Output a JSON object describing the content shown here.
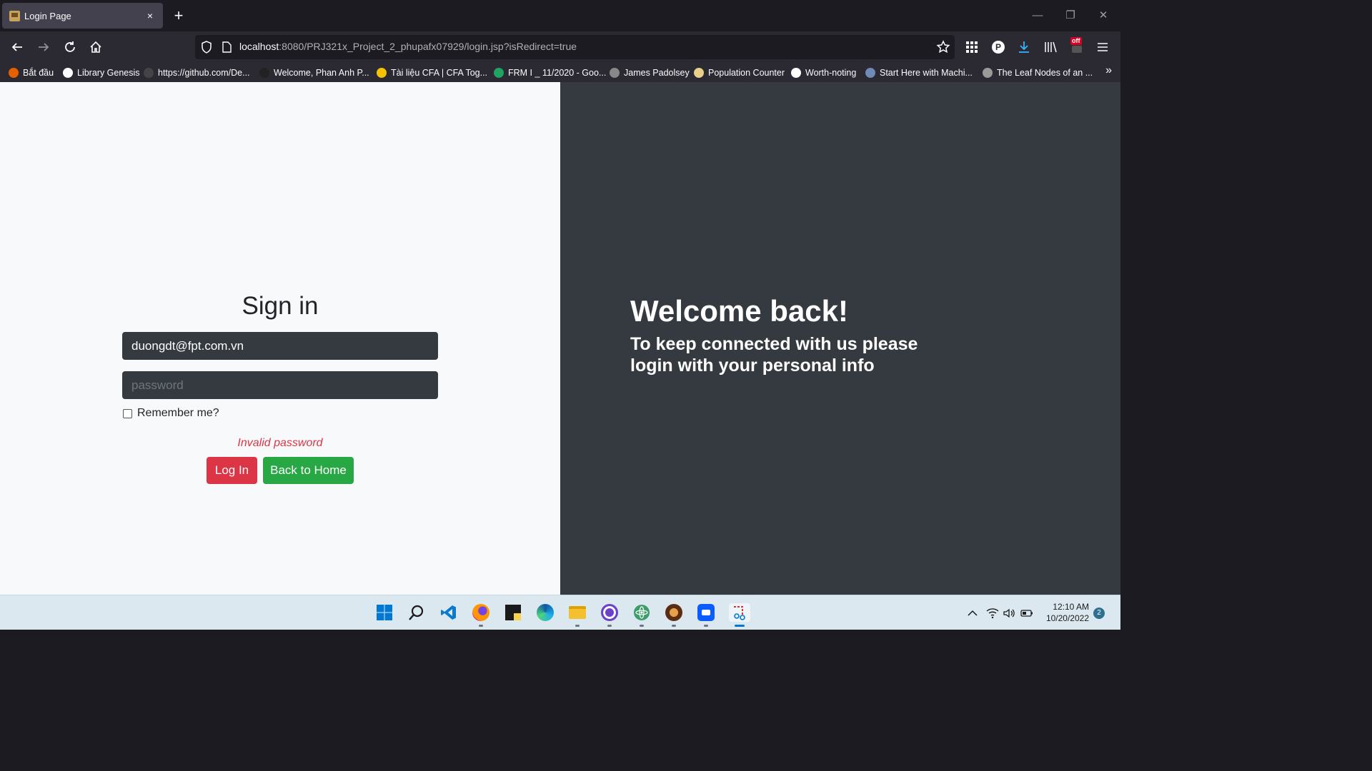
{
  "browser": {
    "tab_title": "Login Page",
    "new_tab_symbol": "+",
    "close_symbol": "×",
    "url_host": "localhost",
    "url_path": ":8080/PRJ321x_Project_2_phupafx07929/login.jsp?isRedirect=true",
    "ext_badge": "off",
    "account_letter": "P"
  },
  "bookmarks": [
    {
      "label": "Bắt đầu",
      "color": "#e66000"
    },
    {
      "label": "Library Genesis",
      "color": "#ffffff"
    },
    {
      "label": "https://github.com/De...",
      "color": "#444444"
    },
    {
      "label": "Welcome, Phan Anh P...",
      "color": "#222222"
    },
    {
      "label": "Tài liệu CFA | CFA Tog...",
      "color": "#f5c400"
    },
    {
      "label": "FRM I _ 11/2020 - Goo...",
      "color": "#1fa463"
    },
    {
      "label": "James Padolsey",
      "color": "#888888"
    },
    {
      "label": "Population Counter",
      "color": "#e8d08a"
    },
    {
      "label": "Worth-noting",
      "color": "#ffffff"
    },
    {
      "label": "Start Here with Machi...",
      "color": "#6e8ab5"
    },
    {
      "label": "The Leaf Nodes of an ...",
      "color": "#9a9a9a"
    }
  ],
  "login": {
    "title": "Sign in",
    "email_value": "duongdt@fpt.com.vn",
    "password_placeholder": "password",
    "remember_label": "Remember me?",
    "error_message": "Invalid password",
    "login_button": "Log In",
    "home_button": "Back to Home"
  },
  "welcome": {
    "title": "Welcome back!",
    "subtitle": "To keep connected with us please login with your personal info"
  },
  "taskbar": {
    "time": "12:10 AM",
    "date": "10/20/2022",
    "notification_count": "2"
  },
  "colors": {
    "danger": "#dc3545",
    "success": "#28a745",
    "dark": "#343a40",
    "light": "#f8f9fa"
  }
}
